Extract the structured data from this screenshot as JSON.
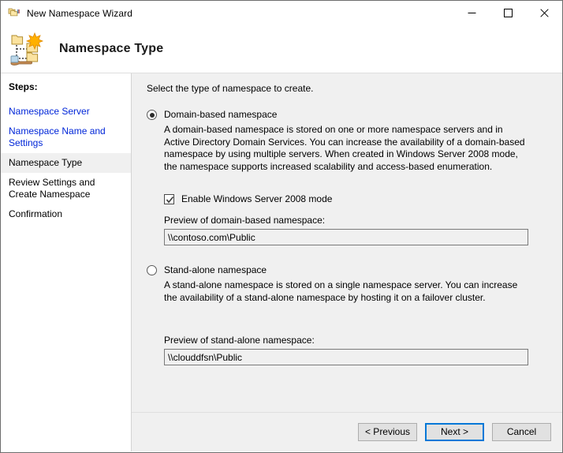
{
  "window": {
    "title": "New Namespace Wizard",
    "icon": "namespace-wizard-icon",
    "minimize_label": "—",
    "maximize_label": "□",
    "close_label": "✕"
  },
  "header": {
    "title": "Namespace Type",
    "icon": "dfs-namespace-icon"
  },
  "sidebar": {
    "heading": "Steps:",
    "items": [
      {
        "label": "Namespace Server",
        "state": "link"
      },
      {
        "label": "Namespace Name and Settings",
        "state": "link"
      },
      {
        "label": "Namespace Type",
        "state": "current"
      },
      {
        "label": "Review Settings and Create Namespace",
        "state": "upcoming"
      },
      {
        "label": "Confirmation",
        "state": "upcoming"
      }
    ]
  },
  "main": {
    "intro": "Select the type of namespace to create.",
    "domain_option": {
      "label": "Domain-based namespace",
      "selected": true,
      "description": "A domain-based namespace is stored on one or more namespace servers and in Active Directory Domain Services. You can increase the availability of a domain-based namespace by using multiple servers. When created in Windows Server 2008 mode, the namespace supports increased scalability and access-based enumeration.",
      "checkbox": {
        "label": "Enable Windows Server 2008 mode",
        "checked": true
      },
      "preview_label": "Preview of domain-based namespace:",
      "preview_value": "\\\\contoso.com\\Public"
    },
    "standalone_option": {
      "label": "Stand-alone namespace",
      "selected": false,
      "description": "A stand-alone namespace is stored on a single namespace server. You can increase the availability of a stand-alone namespace by hosting it on a failover cluster.",
      "preview_label": "Preview of stand-alone namespace:",
      "preview_value": "\\\\clouddfsn\\Public"
    }
  },
  "footer": {
    "previous_label": "< Previous",
    "next_label": "Next >",
    "cancel_label": "Cancel"
  },
  "colors": {
    "link": "#0026d8",
    "panel_bg": "#f0f0f0",
    "accent": "#0078d7",
    "window_bg": "#ffffff"
  }
}
